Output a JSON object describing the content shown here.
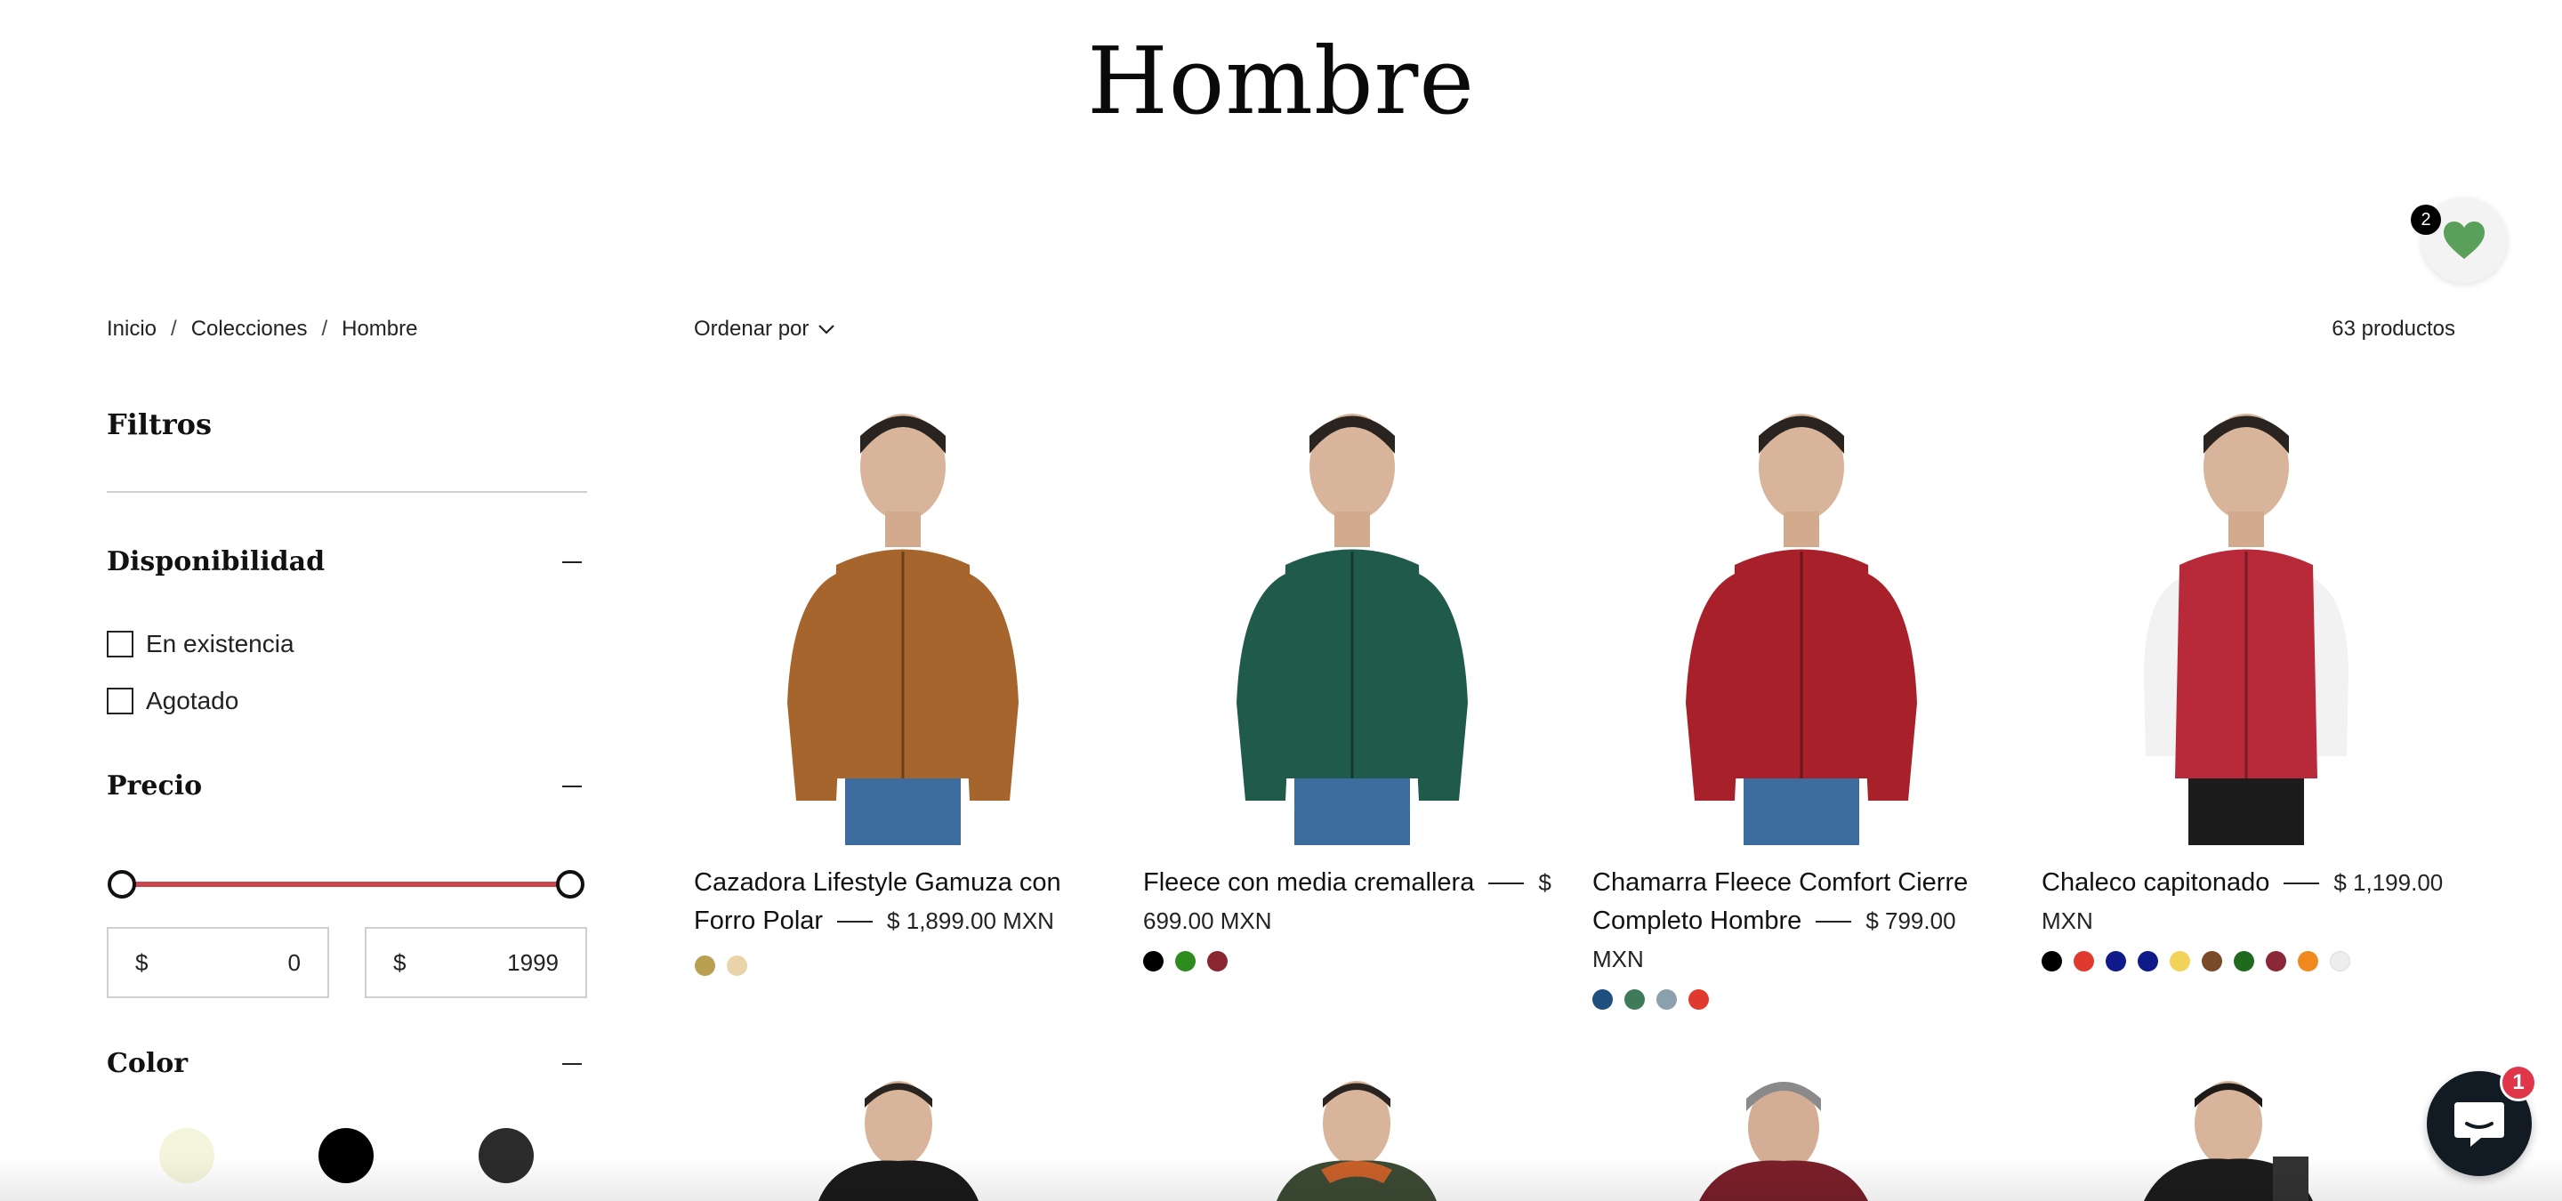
{
  "page": {
    "title": "Hombre"
  },
  "wishlist": {
    "count": "2"
  },
  "breadcrumb": {
    "items": [
      "Inicio",
      "Colecciones",
      "Hombre"
    ],
    "separator": "/"
  },
  "sort": {
    "label": "Ordenar por"
  },
  "results": {
    "count_label": "63 productos"
  },
  "filters": {
    "title": "Filtros",
    "availability": {
      "title": "Disponibilidad",
      "options": [
        "En existencia",
        "Agotado"
      ]
    },
    "price": {
      "title": "Precio",
      "currency": "$",
      "min": "0",
      "max": "1999"
    },
    "color": {
      "title": "Color",
      "swatches": [
        "#f4f4dc",
        "#000000",
        "#2b2b2b"
      ]
    }
  },
  "products": [
    {
      "title": "Cazadora Lifestyle Gamuza con Forro Polar",
      "price": "$ 1,899.00 MXN",
      "garment_color": "#a5652c",
      "swatches": [
        "#b8a050",
        "#e8d4a8"
      ]
    },
    {
      "title": "Fleece con media cremallera",
      "price": "$ 699.00 MXN",
      "garment_color": "#1f5a4a",
      "swatches": [
        "#000000",
        "#2e8b1e",
        "#8b2530"
      ]
    },
    {
      "title": "Chamarra Fleece Comfort Cierre Completo Hombre",
      "price": "$ 799.00 MXN",
      "garment_color": "#a8202a",
      "swatches": [
        "#1f4f7f",
        "#3f7a5a",
        "#8aa0ac",
        "#e03a2e"
      ]
    },
    {
      "title": "Chaleco capitonado",
      "price": "$ 1,199.00 MXN",
      "garment_color": "#b82a3a",
      "swatches": [
        "#000000",
        "#e03a2e",
        "#101a8a",
        "#0f1a8a",
        "#f2d35a",
        "#7a4a28",
        "#1f6a1f",
        "#8b2838",
        "#f08a1e",
        "#ededed"
      ]
    }
  ],
  "chat": {
    "badge": "1"
  }
}
